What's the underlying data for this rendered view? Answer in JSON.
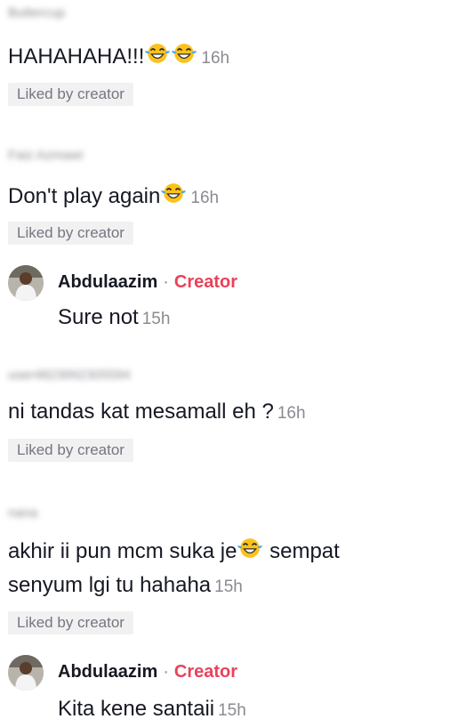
{
  "comments": [
    {
      "username": "Buttercup",
      "text": "HAHAHAHA!!!",
      "emoji_count": 2,
      "time": "16h",
      "badge": "Liked by creator"
    },
    {
      "username": "Faiz Azmawi",
      "text": "Don't play again",
      "emoji_count": 1,
      "time": "16h",
      "badge": "Liked by creator"
    },
    {
      "username": "user4823992305594",
      "text": "ni tandas kat mesamall eh ?",
      "time": "16h",
      "badge": "Liked by creator"
    },
    {
      "username": "nana",
      "text_before": "akhir ii pun mcm suka je",
      "text_after": " sempat",
      "text_line2": "senyum lgi tu hahaha",
      "time": "15h",
      "badge": "Liked by creator"
    }
  ],
  "replies": [
    {
      "name": "Abdulaazim",
      "separator": "·",
      "role": "Creator",
      "text": "Sure not",
      "time": "15h"
    },
    {
      "name": "Abdulaazim",
      "separator": "·",
      "role": "Creator",
      "text": "Kita kene santaii",
      "time": "15h"
    }
  ],
  "colors": {
    "creator": "#e8435a",
    "muted": "#8a8b91",
    "badge_bg": "#f1f1f2",
    "text": "#161823"
  },
  "icons": {
    "emoji": "face-with-tears-of-joy-icon",
    "avatar": "creator-avatar"
  }
}
